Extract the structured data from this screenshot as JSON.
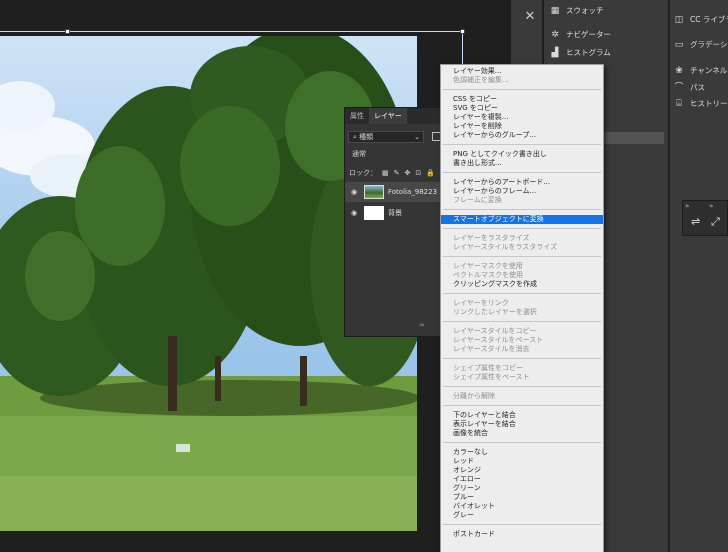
{
  "dock": {
    "col1": [
      {
        "icon": "swatches-icon",
        "label": "スウォッチ"
      },
      {
        "icon": "navigator-icon",
        "label": "ナビゲーター"
      },
      {
        "icon": "histogram-icon",
        "label": "ヒストグラム"
      }
    ],
    "col2": [
      {
        "icon": "cc-libraries-icon",
        "label": "CC ライブラリ"
      },
      {
        "icon": "gradient-icon",
        "label": "グラデーション"
      },
      {
        "icon": "channels-icon",
        "label": "チャンネル"
      },
      {
        "icon": "paths-icon",
        "label": "パス"
      },
      {
        "icon": "history-icon",
        "label": "ヒストリー"
      }
    ]
  },
  "layers_panel": {
    "tabs": [
      "属性",
      "レイヤー"
    ],
    "filter_value": "種類",
    "blend_mode": "通常",
    "lock_label": "ロック：",
    "layers": [
      {
        "name": "Fotolia_98223",
        "visible": true
      },
      {
        "name": "背景",
        "visible": true
      }
    ]
  },
  "context_menu": {
    "groups": [
      [
        {
          "label": "レイヤー効果...",
          "disabled": false
        },
        {
          "label": "色調補正を編集...",
          "disabled": true
        }
      ],
      [
        {
          "label": "CSS をコピー",
          "disabled": false
        },
        {
          "label": "SVG をコピー",
          "disabled": false
        },
        {
          "label": "レイヤーを複製...",
          "disabled": false
        },
        {
          "label": "レイヤーを削除",
          "disabled": false
        },
        {
          "label": "レイヤーからのグループ...",
          "disabled": false
        }
      ],
      [
        {
          "label": "PNG としてクイック書き出し",
          "disabled": false
        },
        {
          "label": "書き出し形式...",
          "disabled": false
        }
      ],
      [
        {
          "label": "レイヤーからのアートボード...",
          "disabled": false
        },
        {
          "label": "レイヤーからのフレーム...",
          "disabled": false
        },
        {
          "label": "フレームに変換",
          "disabled": true
        }
      ],
      [
        {
          "label": "スマートオブジェクトに変換",
          "disabled": false,
          "highlight": true
        }
      ],
      [
        {
          "label": "レイヤーをラスタライズ",
          "disabled": true
        },
        {
          "label": "レイヤースタイルをラスタライズ",
          "disabled": true
        }
      ],
      [
        {
          "label": "レイヤーマスクを使用",
          "disabled": true
        },
        {
          "label": "ベクトルマスクを使用",
          "disabled": true
        },
        {
          "label": "クリッピングマスクを作成",
          "disabled": false
        }
      ],
      [
        {
          "label": "レイヤーをリンク",
          "disabled": true
        },
        {
          "label": "リンクしたレイヤーを選択",
          "disabled": true
        }
      ],
      [
        {
          "label": "レイヤースタイルをコピー",
          "disabled": true
        },
        {
          "label": "レイヤースタイルをペースト",
          "disabled": true
        },
        {
          "label": "レイヤースタイルを消去",
          "disabled": true
        }
      ],
      [
        {
          "label": "シェイプ属性をコピー",
          "disabled": true
        },
        {
          "label": "シェイプ属性をペースト",
          "disabled": true
        }
      ],
      [
        {
          "label": "分離から解除",
          "disabled": true
        }
      ],
      [
        {
          "label": "下のレイヤーと結合",
          "disabled": false
        },
        {
          "label": "表示レイヤーを結合",
          "disabled": false
        },
        {
          "label": "画像を統合",
          "disabled": false
        }
      ],
      [
        {
          "label": "カラーなし",
          "disabled": false
        },
        {
          "label": "レッド",
          "disabled": false
        },
        {
          "label": "オレンジ",
          "disabled": false
        },
        {
          "label": "イエロー",
          "disabled": false
        },
        {
          "label": "グリーン",
          "disabled": false
        },
        {
          "label": "ブルー",
          "disabled": false
        },
        {
          "label": "バイオレット",
          "disabled": false
        },
        {
          "label": "グレー",
          "disabled": false
        }
      ],
      [
        {
          "label": "ポストカード",
          "disabled": false
        }
      ]
    ]
  },
  "colors": {
    "highlight": "#1473e6",
    "menu_bg": "#ededed",
    "dock_bg": "#3a3a3a"
  }
}
